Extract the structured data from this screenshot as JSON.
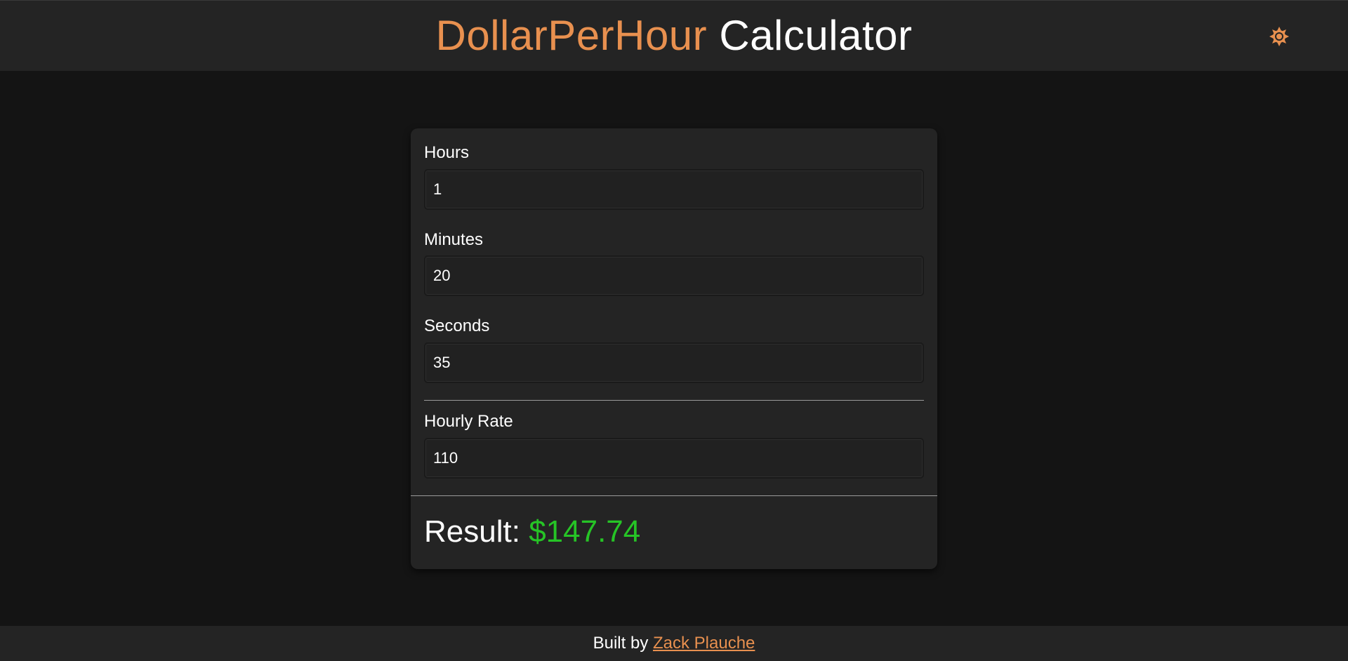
{
  "header": {
    "title_accent": "DollarPerHour",
    "title_main": "Calculator",
    "theme_toggle_icon": "sun-icon"
  },
  "form": {
    "hours": {
      "label": "Hours",
      "value": "1"
    },
    "minutes": {
      "label": "Minutes",
      "value": "20"
    },
    "seconds": {
      "label": "Seconds",
      "value": "35"
    },
    "rate": {
      "label": "Hourly Rate",
      "value": "110"
    }
  },
  "result": {
    "label": "Result:",
    "value": "$147.74"
  },
  "footer": {
    "prefix": "Built by",
    "author": "Zack Plauche"
  },
  "colors": {
    "accent": "#e8904f",
    "result": "#26c426",
    "background": "#141414",
    "surface": "#242424"
  }
}
